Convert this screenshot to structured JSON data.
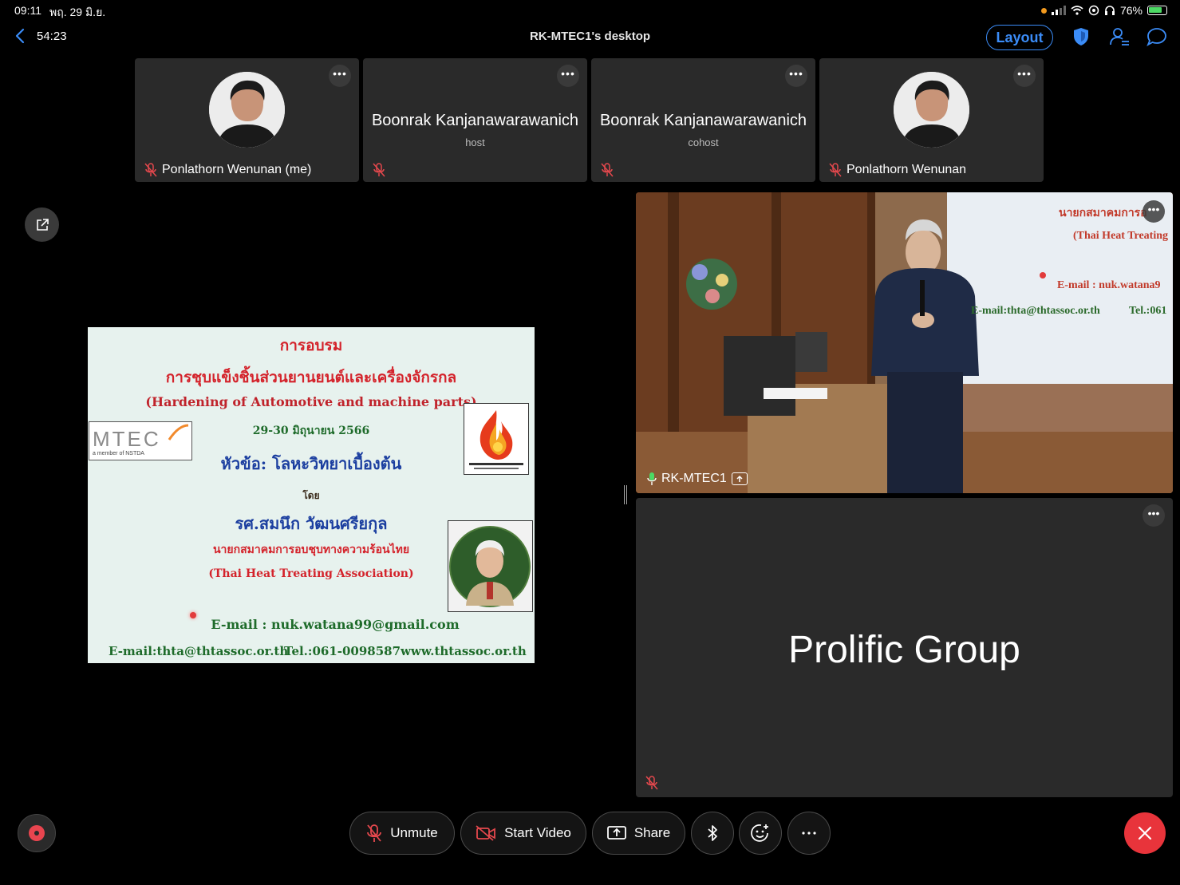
{
  "status_bar": {
    "time": "09:11",
    "date": "พฤ. 29 มิ.ย.",
    "battery": "76%"
  },
  "topbar": {
    "timer": "54:23",
    "title": "RK-MTEC1's desktop",
    "layout_label": "Layout",
    "icons": [
      "shield-icon",
      "participants-icon",
      "chat-icon"
    ]
  },
  "participants": [
    {
      "name": "Ponlathorn Wenunan (me)",
      "avatar": "photo",
      "muted": true
    },
    {
      "name": "Boonrak Kanjanawarawanich",
      "role": "host",
      "muted": true
    },
    {
      "name": "Boonrak Kanjanawarawanich",
      "role": "cohost",
      "muted": true
    },
    {
      "name": "Ponlathorn Wenunan",
      "avatar": "photo",
      "muted": true
    }
  ],
  "slide": {
    "line1": "การอบรม",
    "line2": "การชุบแข็งชิ้นส่วนยานยนต์และเครื่องจักรกล",
    "line3": "(Hardening of Automotive and machine parts)",
    "line4": "29-30 มิถุนายน 2566",
    "line5": "หัวข้อ: โลหะวิทยาเบื้องต้น",
    "line6": "โดย",
    "line7": "รศ.สมนึก  วัฒนศรียกุล",
    "line8": "นายกสมาคมการอบชุบทางความร้อนไทย",
    "line9": "(Thai Heat Treating Association)",
    "line10": "E-mail : nuk.watana99@gmail.com",
    "footer_email": "E-mail:thta@thtassoc.or.th",
    "footer_tel": "Tel.:061-0098587",
    "footer_web": "www.thtassoc.or.th",
    "logo_mtec": "MTEC",
    "logo_mtec_sub": "a member of NSTDA"
  },
  "video_tile": {
    "name": "RK-MTEC1"
  },
  "prolific_tile": {
    "name": "Prolific Group"
  },
  "controls": {
    "unmute": "Unmute",
    "start_video": "Start Video",
    "share": "Share"
  },
  "colors": {
    "accent": "#3b8cf7",
    "end_call": "#e8343b",
    "tile_bg": "#2a2a2a",
    "muted_red": "#e5484d"
  }
}
